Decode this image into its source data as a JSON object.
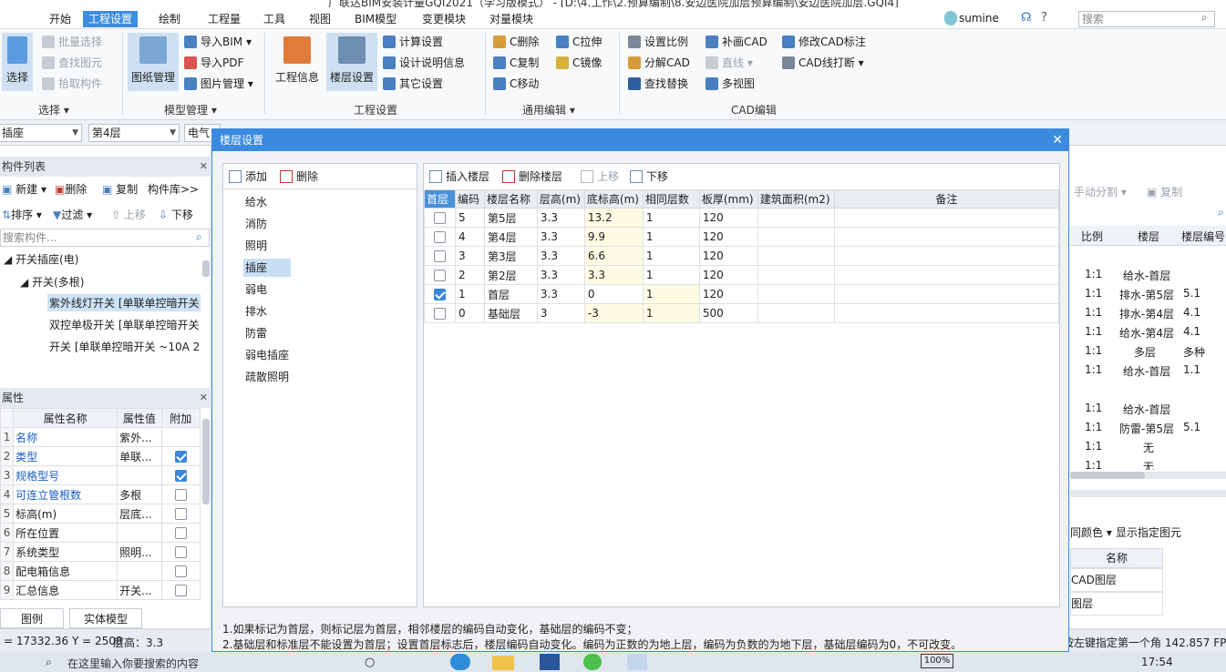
{
  "window": {
    "title": "广联达BIM安装计量GQI2021（学习版模式） - [D:\\4.工作\\2.预算编制\\8.安边医院加层预算编制\\安边医院加层.GQI4]",
    "user": "sumine",
    "search_placeholder": "搜索",
    "help": "?"
  },
  "menu": [
    "开始",
    "工程设置",
    "绘制",
    "工程量",
    "工具",
    "视图",
    "BIM模型",
    "变更模块",
    "对量模块"
  ],
  "ribbon": {
    "select": {
      "big": "选择",
      "items": [
        "批量选择",
        "查找图元",
        "拾取构件"
      ],
      "group": "选择"
    },
    "model": {
      "big": "图纸管理",
      "items": [
        "导入BIM",
        "导入PDF",
        "图片管理"
      ],
      "group": "模型管理"
    },
    "project": {
      "big1": "工程信息",
      "big2": "楼层设置",
      "items": [
        "计算设置",
        "设计说明信息",
        "其它设置"
      ],
      "group": "工程设置"
    },
    "edit": {
      "items": [
        "C删除",
        "C复制",
        "C移动",
        "C拉伸",
        "C镜像"
      ],
      "group": "通用编辑"
    },
    "cad": {
      "items": [
        "设置比例",
        "分解CAD",
        "查找替换",
        "补画CAD",
        "直线",
        "多视图",
        "修改CAD标注",
        "CAD线打断"
      ],
      "group": "CAD编辑"
    }
  },
  "combos": [
    "插座",
    "第4层",
    "电气"
  ],
  "left": {
    "list_title": "构件列表",
    "toolbar1": [
      "新建",
      "删除",
      "复制",
      "构件库>>"
    ],
    "toolbar2": [
      "排序",
      "过滤",
      "上移",
      "下移"
    ],
    "search_placeholder": "搜索构件...",
    "tree": [
      "开关插座(电)",
      "开关(多根)",
      "紫外线灯开关 [单联单控暗开关",
      "双控单极开关 [单联单控暗开关",
      "开关 [单联单控暗开关 ~10A 25"
    ],
    "props_title": "属性",
    "prop_headers": [
      "属性名称",
      "属性值",
      "附加"
    ],
    "props": [
      {
        "n": "1",
        "name": "名称",
        "val": "紫外...",
        "add": ""
      },
      {
        "n": "2",
        "name": "类型",
        "val": "单联...",
        "add": "on"
      },
      {
        "n": "3",
        "name": "规格型号",
        "val": "",
        "add": "on"
      },
      {
        "n": "4",
        "name": "可连立管根数",
        "val": "多根",
        "add": "off"
      },
      {
        "n": "5",
        "name": "标高(m)",
        "val": "层底...",
        "add": "off"
      },
      {
        "n": "6",
        "name": "所在位置",
        "val": "",
        "add": "off"
      },
      {
        "n": "7",
        "name": "系统类型",
        "val": "照明...",
        "add": "off"
      },
      {
        "n": "8",
        "name": "配电箱信息",
        "val": "",
        "add": "off"
      },
      {
        "n": "9",
        "name": "汇总信息",
        "val": "开关...",
        "add": "off"
      }
    ],
    "tabs": [
      "图例",
      "实体模型"
    ]
  },
  "dialog": {
    "title": "楼层设置",
    "left_toolbar": [
      "添加",
      "删除"
    ],
    "professions": [
      "给水",
      "消防",
      "照明",
      "插座",
      "弱电",
      "排水",
      "防雷",
      "弱电插座",
      "疏散照明"
    ],
    "right_toolbar": [
      "插入楼层",
      "删除楼层",
      "上移",
      "下移"
    ],
    "headers": [
      "首层",
      "编码",
      "楼层名称",
      "层高(m)",
      "底标高(m)",
      "相同层数",
      "板厚(mm)",
      "建筑面积(m2)",
      "备注"
    ],
    "rows": [
      {
        "first": false,
        "code": "5",
        "name": "第5层",
        "h": "3.3",
        "bottom": "13.2",
        "same": "1",
        "thick": "120",
        "area": "",
        "note": ""
      },
      {
        "first": false,
        "code": "4",
        "name": "第4层",
        "h": "3.3",
        "bottom": "9.9",
        "same": "1",
        "thick": "120",
        "area": "",
        "note": ""
      },
      {
        "first": false,
        "code": "3",
        "name": "第3层",
        "h": "3.3",
        "bottom": "6.6",
        "same": "1",
        "thick": "120",
        "area": "",
        "note": ""
      },
      {
        "first": false,
        "code": "2",
        "name": "第2层",
        "h": "3.3",
        "bottom": "3.3",
        "same": "1",
        "thick": "120",
        "area": "",
        "note": ""
      },
      {
        "first": true,
        "code": "1",
        "name": "首层",
        "h": "3.3",
        "bottom": "0",
        "same": "1",
        "thick": "120",
        "area": "",
        "note": ""
      },
      {
        "first": false,
        "code": "0",
        "name": "基础层",
        "h": "3",
        "bottom": "-3",
        "same": "1",
        "thick": "500",
        "area": "",
        "note": ""
      }
    ],
    "note1": "1.如果标记为首层，则标记层为首层，相邻楼层的编码自动变化，基础层的编码不变；",
    "note2": "2.基础层和标准层不能设置为首层；设置首层标志后，楼层编码自动变化。编码为正数的为地上层，编码为负数的为地下层，基础层编码为0，不可改变。"
  },
  "right": {
    "toolbar": [
      "手动分割",
      "复制"
    ],
    "headers": [
      "比例",
      "楼层",
      "楼层编号"
    ],
    "rows": [
      [
        "",
        "",
        ""
      ],
      [
        "1:1",
        "给水-首层",
        ""
      ],
      [
        "1:1",
        "排水-第5层",
        "5.1"
      ],
      [
        "1:1",
        "排水-第4层",
        "4.1"
      ],
      [
        "1:1",
        "给水-第4层",
        "4.1"
      ],
      [
        "1:1",
        "多层",
        "多种"
      ],
      [
        "1:1",
        "给水-首层",
        "1.1"
      ],
      [
        "",
        "",
        ""
      ],
      [
        "1:1",
        "给水-首层",
        ""
      ],
      [
        "1:1",
        "防雷-第5层",
        "5.1"
      ],
      [
        "1:1",
        "无",
        ""
      ],
      [
        "1:1",
        "无",
        ""
      ]
    ],
    "color_toolbar": [
      "同颜色",
      "显示指定图元"
    ],
    "layer_header": "名称",
    "layers": [
      "CAD图层",
      "图层"
    ]
  },
  "status": {
    "coords": "= 17332.36 Y = 2508",
    "floor_height": "层高：3.3",
    "hint": "按左键指定第一个角 142.857 FPS"
  },
  "taskbar": {
    "search": "在这里输入你要搜索的内容",
    "time": "17:54",
    "battery": "100%"
  }
}
